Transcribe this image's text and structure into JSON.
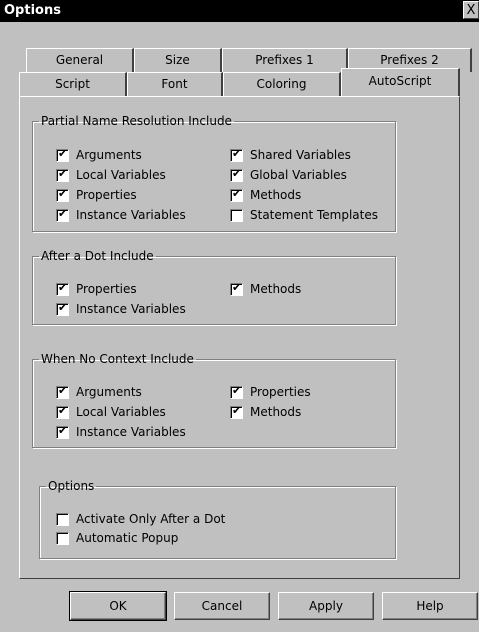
{
  "window": {
    "title": "Options",
    "close_glyph": "X"
  },
  "tabs": {
    "row_back": [
      "General",
      "Size",
      "Prefixes 1",
      "Prefixes 2"
    ],
    "row_front": [
      "Script",
      "Font",
      "Coloring",
      "AutoScript"
    ],
    "active": "AutoScript"
  },
  "groups": {
    "partial": {
      "title": "Partial Name Resolution Include",
      "items": [
        {
          "label": "Arguments",
          "checked": true
        },
        {
          "label": "Local Variables",
          "checked": true
        },
        {
          "label": "Properties",
          "checked": true
        },
        {
          "label": "Instance Variables",
          "checked": true
        },
        {
          "label": "Shared Variables",
          "checked": true
        },
        {
          "label": "Global Variables",
          "checked": true
        },
        {
          "label": "Methods",
          "checked": true
        },
        {
          "label": "Statement Templates",
          "checked": false
        }
      ]
    },
    "after_dot": {
      "title": "After a Dot Include",
      "items": [
        {
          "label": "Properties",
          "checked": true
        },
        {
          "label": "Instance Variables",
          "checked": true
        },
        {
          "label": "Methods",
          "checked": true
        }
      ]
    },
    "no_context": {
      "title": "When No Context Include",
      "items": [
        {
          "label": "Arguments",
          "checked": true
        },
        {
          "label": "Local Variables",
          "checked": true
        },
        {
          "label": "Instance Variables",
          "checked": true
        },
        {
          "label": "Properties",
          "checked": true
        },
        {
          "label": "Methods",
          "checked": true
        }
      ]
    },
    "options": {
      "title": "Options",
      "items": [
        {
          "label": "Activate Only After a Dot",
          "checked": false
        },
        {
          "label": "Automatic Popup",
          "checked": false
        }
      ]
    }
  },
  "buttons": {
    "ok": "OK",
    "cancel": "Cancel",
    "apply": "Apply",
    "help": "Help"
  }
}
